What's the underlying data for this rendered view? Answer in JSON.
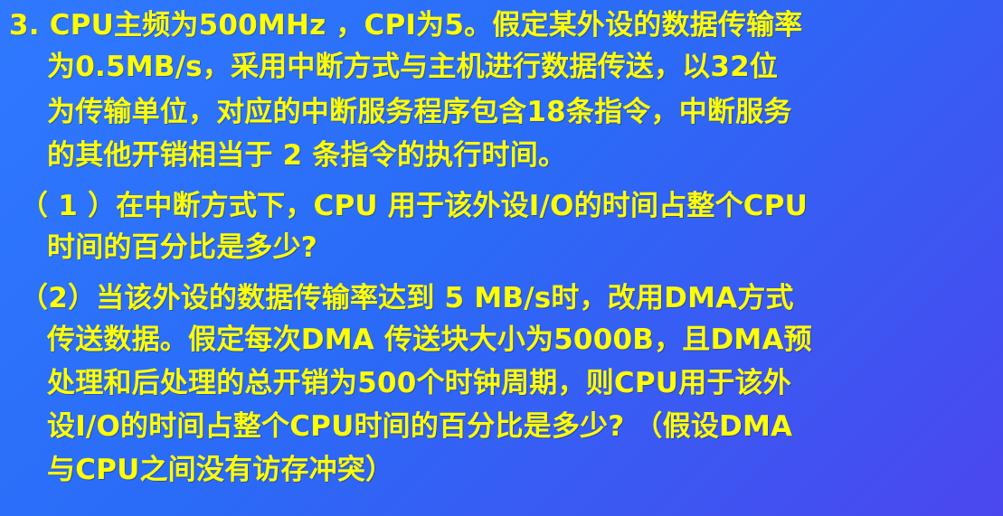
{
  "lines": [
    "3. CPU主频为500MHz ，CPI为5。假定某外设的数据传输率",
    "为0.5MB/s，采用中断方式与主机进行数据传送，以32位",
    "为传输单位，对应的中断服务程序包含18条指令，中断服务",
    "的其他开销相当于 2 条指令的执行时间。",
    "（ 1 ）在中断方式下，CPU 用于该外设I/O的时间占整个CPU",
    "时间的百分比是多少?",
    "（2）当该外设的数据传输率达到 5 MB/s时，改用DMA方式",
    "传送数据。假定每次DMA 传送块大小为5000B，且DMA预",
    "处理和后处理的总开销为500个时钟周期，则CPU用于该外",
    "设I/O的时间占整个CPU时间的百分比是多少? （假设DMA",
    "与CPU之间没有访存冲突）"
  ],
  "colors": {
    "text": "#ffff00",
    "background_start": "#2f79ff",
    "background_end": "#4b47ef"
  }
}
